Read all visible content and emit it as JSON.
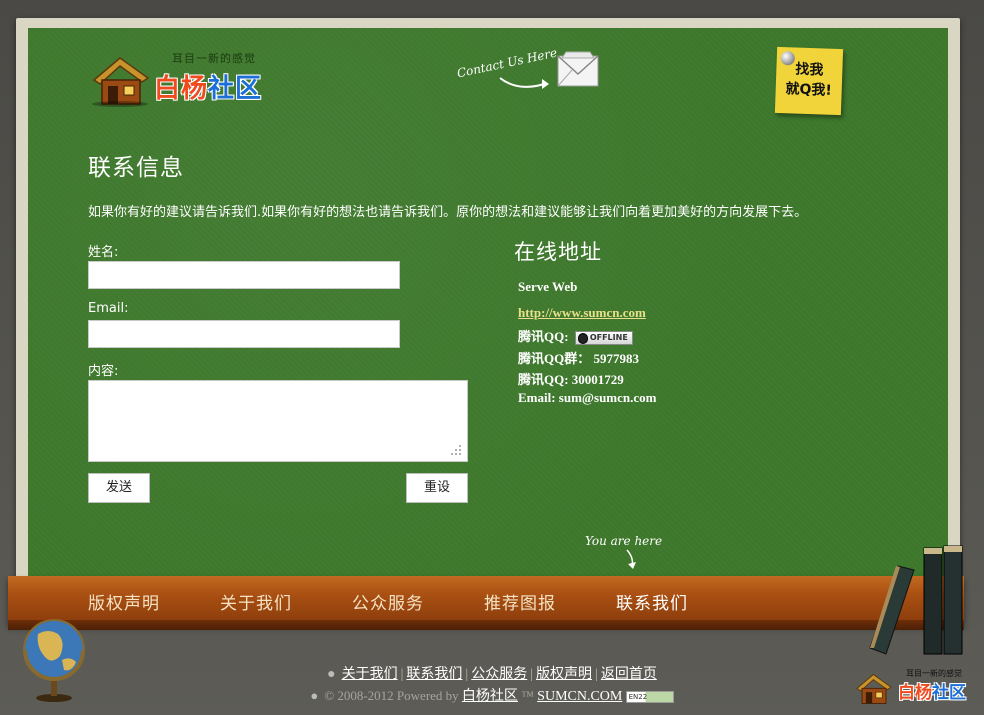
{
  "header": {
    "logo_tagline": "耳目一新的感觉",
    "logo_name_part1": "白杨",
    "logo_name_part2": "社区",
    "contact_hint": "Contact Us Here",
    "sticky_line1": "找我",
    "sticky_line2": "就Q我!"
  },
  "page": {
    "title": "联系信息",
    "intro": "如果你有好的建议请告诉我们.如果你有好的想法也请告诉我们。原你的想法和建议能够让我们向着更加美好的方向发展下去。"
  },
  "form": {
    "name_label": "姓名:",
    "name_value": "",
    "email_label": "Email:",
    "email_value": "",
    "content_label": "内容:",
    "content_value": "",
    "submit_label": "发送",
    "reset_label": "重设"
  },
  "online": {
    "title": "在线地址",
    "serve": "Serve Web",
    "url": "http://www.sumcn.com",
    "qq1_label": "腾讯QQ:",
    "qq_status": "OFFLINE",
    "qq_group": "腾讯QQ群： 5977983",
    "qq2": "腾讯QQ: 30001729",
    "email": "Email: sum@sumcn.com"
  },
  "you_are_here": "You are here",
  "nav": {
    "items": [
      {
        "label": "版权声明"
      },
      {
        "label": "关于我们"
      },
      {
        "label": "公众服务"
      },
      {
        "label": "推荐图报"
      },
      {
        "label": "联系我们"
      }
    ],
    "active_index": 4
  },
  "footer": {
    "links": [
      "关于我们",
      "联系我们",
      "公众服务",
      "版权声明",
      "返回首页"
    ],
    "copyright_prefix": "© 2008-2012 Powered by",
    "brand": "白杨社区",
    "tm": "™",
    "site": "SUMCN.COM",
    "badge": "EN22",
    "logo_tag": "耳目一新的感觉",
    "logo_part1": "白杨",
    "logo_part2": "社区"
  },
  "colors": {
    "board": "#3f7a2d",
    "shelf": "#a94f12",
    "link": "#e8e08a",
    "sticky": "#f1d43a"
  }
}
